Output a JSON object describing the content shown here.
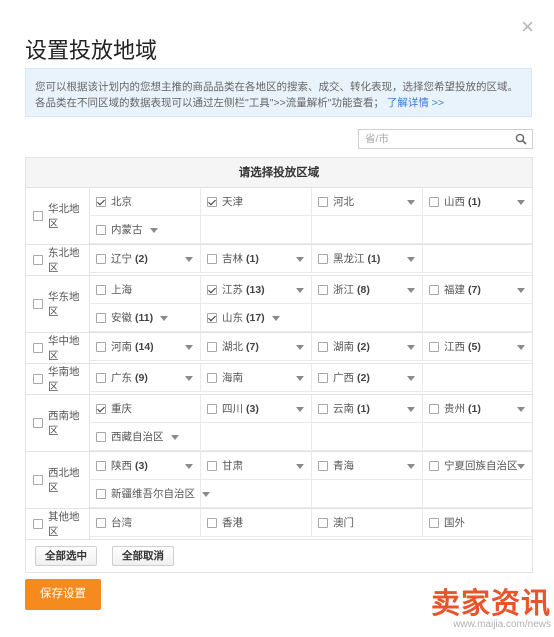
{
  "dialog": {
    "title": "设置投放地域",
    "close": "×",
    "notice_text": "您可以根据该计划内的您想主推的商品品类在各地区的搜索、成交、转化表现，选择您希望投放的区域。各品类在不同区域的数据表现可以通过左侧栏\"工具\">>流量解析\"功能查看；",
    "notice_link": "了解详情 >>"
  },
  "search": {
    "placeholder": "省/市",
    "value": ""
  },
  "grid": {
    "header": "请选择投放区域",
    "regions": [
      {
        "name": "华北地区",
        "checked": false,
        "provinces": [
          {
            "name": "北京",
            "count": "",
            "checked": true,
            "caret": false
          },
          {
            "name": "天津",
            "count": "",
            "checked": true,
            "caret": false
          },
          {
            "name": "河北",
            "count": "",
            "checked": false,
            "caret": true
          },
          {
            "name": "山西",
            "count": "(1)",
            "checked": false,
            "caret": true
          },
          {
            "name": "内蒙古",
            "count": "",
            "checked": false,
            "caret": true
          }
        ]
      },
      {
        "name": "东北地区",
        "checked": false,
        "provinces": [
          {
            "name": "辽宁",
            "count": "(2)",
            "checked": false,
            "caret": true
          },
          {
            "name": "吉林",
            "count": "(1)",
            "checked": false,
            "caret": true
          },
          {
            "name": "黑龙江",
            "count": "(1)",
            "checked": false,
            "caret": true
          }
        ]
      },
      {
        "name": "华东地区",
        "checked": false,
        "provinces": [
          {
            "name": "上海",
            "count": "",
            "checked": false,
            "caret": false
          },
          {
            "name": "江苏",
            "count": "(13)",
            "checked": true,
            "caret": true
          },
          {
            "name": "浙江",
            "count": "(8)",
            "checked": false,
            "caret": true
          },
          {
            "name": "福建",
            "count": "(7)",
            "checked": false,
            "caret": true
          },
          {
            "name": "安徽",
            "count": "(11)",
            "checked": false,
            "caret": true
          },
          {
            "name": "山东",
            "count": "(17)",
            "checked": true,
            "caret": true
          }
        ]
      },
      {
        "name": "华中地区",
        "checked": false,
        "provinces": [
          {
            "name": "河南",
            "count": "(14)",
            "checked": false,
            "caret": true
          },
          {
            "name": "湖北",
            "count": "(7)",
            "checked": false,
            "caret": true
          },
          {
            "name": "湖南",
            "count": "(2)",
            "checked": false,
            "caret": true
          },
          {
            "name": "江西",
            "count": "(5)",
            "checked": false,
            "caret": true
          }
        ]
      },
      {
        "name": "华南地区",
        "checked": false,
        "provinces": [
          {
            "name": "广东",
            "count": "(9)",
            "checked": false,
            "caret": true
          },
          {
            "name": "海南",
            "count": "",
            "checked": false,
            "caret": true
          },
          {
            "name": "广西",
            "count": "(2)",
            "checked": false,
            "caret": true
          }
        ]
      },
      {
        "name": "西南地区",
        "checked": false,
        "provinces": [
          {
            "name": "重庆",
            "count": "",
            "checked": true,
            "caret": false
          },
          {
            "name": "四川",
            "count": "(3)",
            "checked": false,
            "caret": true
          },
          {
            "name": "云南",
            "count": "(1)",
            "checked": false,
            "caret": true
          },
          {
            "name": "贵州",
            "count": "(1)",
            "checked": false,
            "caret": true
          },
          {
            "name": "西藏自治区",
            "count": "",
            "checked": false,
            "caret": true
          }
        ]
      },
      {
        "name": "西北地区",
        "checked": false,
        "provinces": [
          {
            "name": "陕西",
            "count": "(3)",
            "checked": false,
            "caret": true
          },
          {
            "name": "甘肃",
            "count": "",
            "checked": false,
            "caret": true
          },
          {
            "name": "青海",
            "count": "",
            "checked": false,
            "caret": true
          },
          {
            "name": "宁夏回族自治区",
            "count": "",
            "checked": false,
            "caret": true
          },
          {
            "name": "新疆维吾尔自治区",
            "count": "",
            "checked": false,
            "caret": true
          }
        ]
      },
      {
        "name": "其他地区",
        "checked": false,
        "provinces": [
          {
            "name": "台湾",
            "count": "",
            "checked": false,
            "caret": false
          },
          {
            "name": "香港",
            "count": "",
            "checked": false,
            "caret": false
          },
          {
            "name": "澳门",
            "count": "",
            "checked": false,
            "caret": false
          },
          {
            "name": "国外",
            "count": "",
            "checked": false,
            "caret": false
          }
        ]
      }
    ],
    "select_all": "全部选中",
    "deselect_all": "全部取消"
  },
  "save_label": "保存设置",
  "watermark": {
    "big": "卖家资讯",
    "small": "www.maijia.com/news"
  },
  "colors": {
    "accent": "#f58a1f",
    "link": "#3a7bd5",
    "notice_bg": "#e9f3fb",
    "watermark": "#e9542b"
  }
}
